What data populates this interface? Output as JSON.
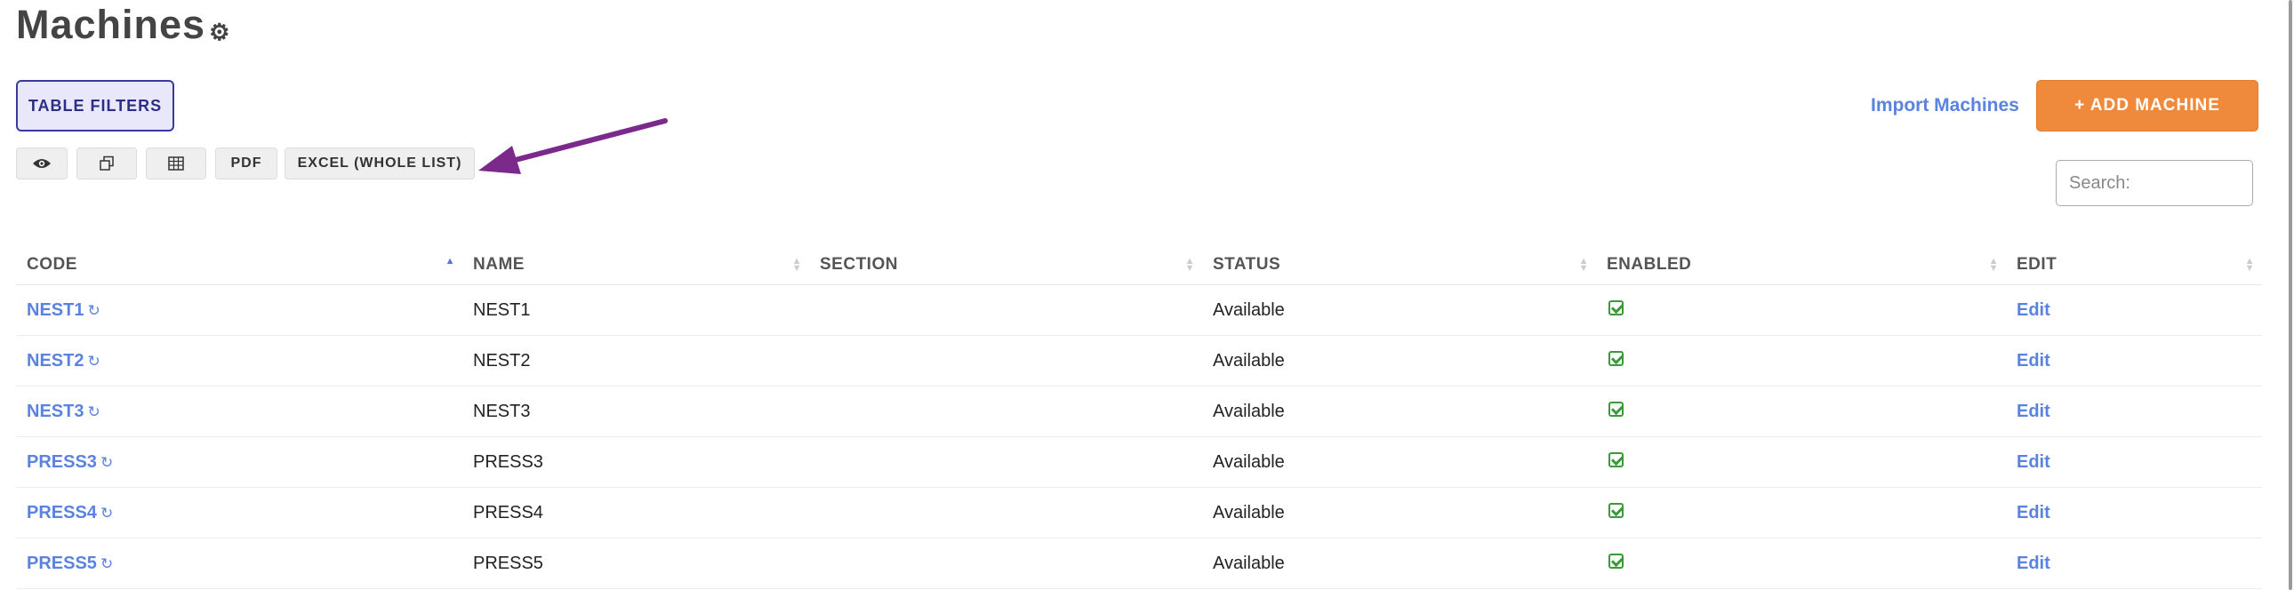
{
  "page": {
    "title": "Machines"
  },
  "toolbar": {
    "filters_label": "TABLE FILTERS",
    "pdf_label": "PDF",
    "excel_label": "EXCEL (WHOLE LIST)",
    "import_label": "Import Machines",
    "add_label": "+ ADD MACHINE",
    "search_placeholder": "Search:"
  },
  "colors": {
    "accent_orange": "#ef8a3c",
    "link_blue": "#5a82e0",
    "filter_border": "#3a3a9a",
    "arrow_purple": "#7b2a8c",
    "check_green": "#3a9a3a"
  },
  "table": {
    "columns": [
      "CODE",
      "NAME",
      "SECTION",
      "STATUS",
      "ENABLED",
      "EDIT"
    ],
    "sorted_by": "CODE",
    "sort_direction": "ascending",
    "rows": [
      {
        "code": "NEST1",
        "name": "NEST1",
        "section": "",
        "status": "Available",
        "enabled": true,
        "edit": "Edit"
      },
      {
        "code": "NEST2",
        "name": "NEST2",
        "section": "",
        "status": "Available",
        "enabled": true,
        "edit": "Edit"
      },
      {
        "code": "NEST3",
        "name": "NEST3",
        "section": "",
        "status": "Available",
        "enabled": true,
        "edit": "Edit"
      },
      {
        "code": "PRESS3",
        "name": "PRESS3",
        "section": "",
        "status": "Available",
        "enabled": true,
        "edit": "Edit"
      },
      {
        "code": "PRESS4",
        "name": "PRESS4",
        "section": "",
        "status": "Available",
        "enabled": true,
        "edit": "Edit"
      },
      {
        "code": "PRESS5",
        "name": "PRESS5",
        "section": "",
        "status": "Available",
        "enabled": true,
        "edit": "Edit"
      }
    ]
  }
}
